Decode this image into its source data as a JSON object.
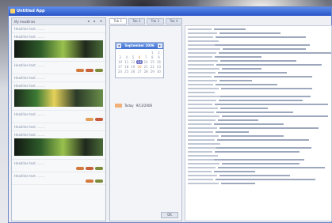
{
  "window": {
    "title": "Untitled App"
  },
  "news": {
    "header": "My headlines",
    "controls": [
      "◂",
      "▸",
      "▾"
    ],
    "items": [
      {
        "title": "Headline text ........",
        "thumb": false,
        "badges": []
      },
      {
        "title": "Headline text ........",
        "thumb": true,
        "badges": []
      },
      {
        "title": "Headline text ........",
        "thumb": false,
        "badges": [
          "#d27a3c",
          "#c5623a",
          "#7d8a3a"
        ]
      },
      {
        "title": "Headline text ........",
        "thumb": false,
        "badges": []
      },
      {
        "title": "Headline text ........",
        "thumb": true,
        "badges": []
      },
      {
        "title": "Headline text ........",
        "thumb": false,
        "badges": [
          "#e0a05a",
          "#c55a3a"
        ]
      },
      {
        "title": "Headline text ........",
        "thumb": false,
        "badges": []
      },
      {
        "title": "Headline text ........",
        "thumb": true,
        "badges": []
      },
      {
        "title": "Headline text ........",
        "thumb": false,
        "badges": [
          "#d27a3c",
          "#c5623a",
          "#7d8a3a"
        ]
      },
      {
        "title": "Headline text ........",
        "thumb": false,
        "badges": [
          "#d27a3c",
          "#7d8a3a"
        ]
      }
    ]
  },
  "tabs": [
    "Tab 1",
    "Tab 2",
    "Tab 3",
    "Tab 4"
  ],
  "calendar": {
    "month": "September 2006",
    "prev": "◂",
    "next": "▸",
    "days": [
      "",
      "",
      "",
      "",
      "",
      "1",
      "2",
      "3",
      "4",
      "5",
      "6",
      "7",
      "8",
      "9",
      "10",
      "11",
      "12",
      "13",
      "14",
      "15",
      "16",
      "17",
      "18",
      "19",
      "20",
      "21",
      "22",
      "23",
      "24",
      "25",
      "26",
      "27",
      "28",
      "29",
      "30"
    ],
    "today": "13",
    "marked": [
      "6",
      "20"
    ],
    "legend_label": "Today",
    "legend_value": "9/13/2006",
    "footer_button": "OK"
  },
  "log": {
    "lines": 40
  }
}
